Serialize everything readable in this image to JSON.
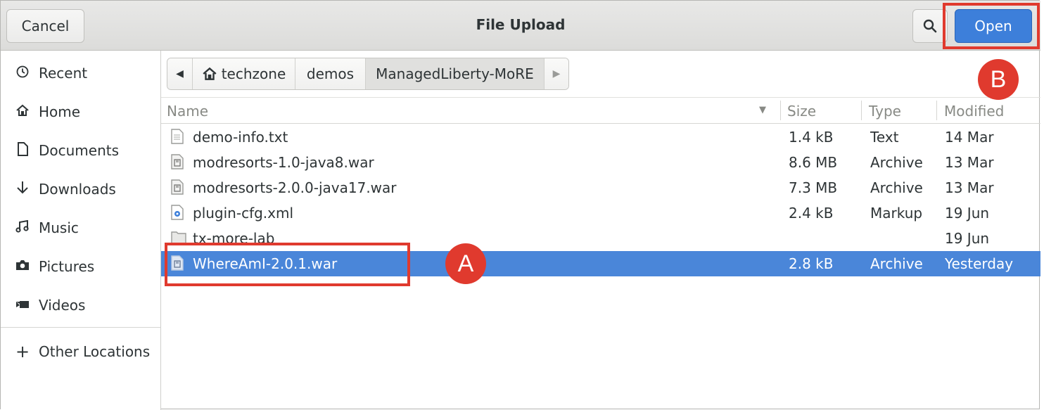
{
  "dialog": {
    "title": "File Upload",
    "cancel_label": "Cancel",
    "open_label": "Open"
  },
  "sidebar": {
    "items": [
      {
        "label": "Recent",
        "icon": "clock-icon"
      },
      {
        "label": "Home",
        "icon": "home-icon"
      },
      {
        "label": "Documents",
        "icon": "document-icon"
      },
      {
        "label": "Downloads",
        "icon": "download-icon"
      },
      {
        "label": "Music",
        "icon": "music-icon"
      },
      {
        "label": "Pictures",
        "icon": "camera-icon"
      },
      {
        "label": "Videos",
        "icon": "video-icon"
      }
    ],
    "other_locations": "Other Locations"
  },
  "pathbar": {
    "segments": [
      "techzone",
      "demos",
      "ManagedLiberty-MoRE"
    ]
  },
  "columns": {
    "name": "Name",
    "size": "Size",
    "type": "Type",
    "modified": "Modified"
  },
  "files": [
    {
      "name": "demo-info.txt",
      "size": "1.4 kB",
      "type": "Text",
      "modified": "14 Mar",
      "icon": "text-file-icon"
    },
    {
      "name": "modresorts-1.0-java8.war",
      "size": "8.6 MB",
      "type": "Archive",
      "modified": "13 Mar",
      "icon": "archive-icon"
    },
    {
      "name": "modresorts-2.0.0-java17.war",
      "size": "7.3 MB",
      "type": "Archive",
      "modified": "13 Mar",
      "icon": "archive-icon"
    },
    {
      "name": "plugin-cfg.xml",
      "size": "2.4 kB",
      "type": "Markup",
      "modified": "19 Jun",
      "icon": "markup-file-icon"
    },
    {
      "name": "tx-more-lab",
      "size": "",
      "type": "",
      "modified": "19 Jun",
      "icon": "folder-icon"
    },
    {
      "name": "WhereAmI-2.0.1.war",
      "size": "2.8 kB",
      "type": "Archive",
      "modified": "Yesterday",
      "icon": "archive-icon",
      "selected": true
    }
  ],
  "annotations": {
    "a": "A",
    "b": "B"
  },
  "colors": {
    "accent": "#4a86d9",
    "open_button": "#3d7fda",
    "annotation": "#e03a2e"
  }
}
